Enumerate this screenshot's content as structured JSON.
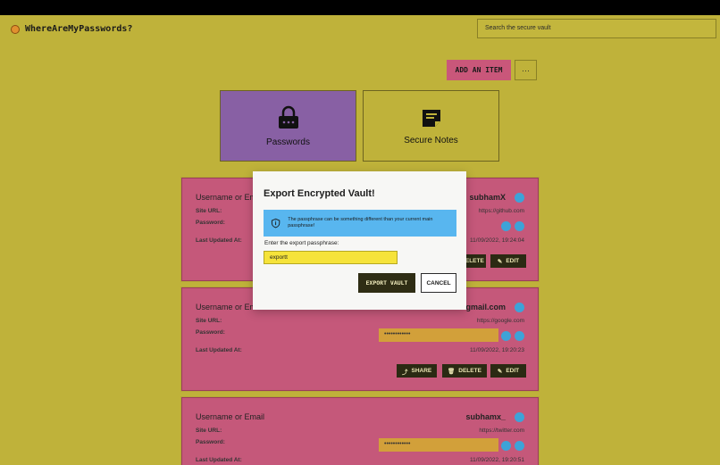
{
  "app": {
    "title": "WhereAreMyPasswords?"
  },
  "header": {
    "search_placeholder": "Search the secure vault"
  },
  "actions": {
    "add_label": "ADD AN ITEM",
    "more_label": "···"
  },
  "categories": [
    {
      "label": "Passwords",
      "icon": "lock-icon"
    },
    {
      "label": "Secure Notes",
      "icon": "notes-icon"
    }
  ],
  "cards": [
    {
      "title": "Username or Email",
      "username": "subhamX",
      "site_label": "Site URL:",
      "site_url": "https://github.com",
      "password_label": "Password:",
      "last_updated_label": "Last Updated At:",
      "last_updated": "11/09/2022, 19:24:04",
      "delete_label": "DELETE",
      "edit_label": "EDIT"
    },
    {
      "title": "Username or Email",
      "username": "gmail.com",
      "site_label": "Site URL:",
      "site_url": "https://google.com",
      "password_label": "Password:",
      "password_mask": "••••••••••••",
      "last_updated_label": "Last Updated At:",
      "last_updated": "11/09/2022, 19:20:23",
      "share_label": "SHARE",
      "delete_label": "DELETE",
      "edit_label": "EDIT"
    },
    {
      "title": "Username or Email",
      "username": "subhamx_",
      "site_label": "Site URL:",
      "site_url": "https://twitter.com",
      "password_label": "Password:",
      "password_mask": "••••••••••••",
      "last_updated_label": "Last Updated At:",
      "last_updated": "11/09/2022, 19:20:51"
    }
  ],
  "modal": {
    "title": "Export Encrypted Vault!",
    "info": "The passphrase can be something different than your current main passphrase!",
    "passphrase_label": "Enter the export passphrase:",
    "passphrase_value": "exportt",
    "export_label": "EXPORT VAULT",
    "cancel_label": "CANCEL"
  }
}
